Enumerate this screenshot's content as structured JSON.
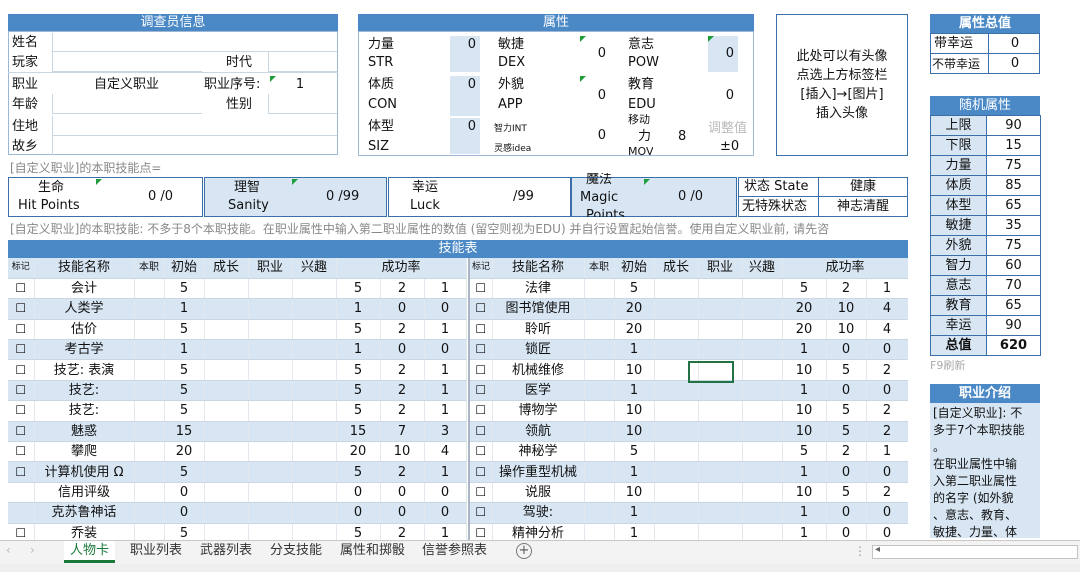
{
  "investigator": {
    "header": "调查员信息",
    "name_label": "姓名",
    "player_label": "玩家",
    "era_label": "时代",
    "occupation_label": "职业",
    "occupation_value": "自定义职业",
    "occ_index_label": "职业序号:",
    "occ_index_value": "1",
    "age_label": "年龄",
    "gender_label": "性别",
    "residence_label": "住地",
    "hometown_label": "故乡"
  },
  "attributes": {
    "header": "属性",
    "items": [
      {
        "cn": "力量",
        "en": "STR",
        "value": "0"
      },
      {
        "cn": "体质",
        "en": "CON",
        "value": "0"
      },
      {
        "cn": "体型",
        "en": "SIZ",
        "value": "0"
      },
      {
        "cn": "敏捷",
        "en": "DEX",
        "value": "0"
      },
      {
        "cn": "外貌",
        "en": "APP",
        "value": "0"
      },
      {
        "cn": "智力INT",
        "en": "灵感idea",
        "value": "0"
      },
      {
        "cn": "意志",
        "en": "POW",
        "value": "0"
      },
      {
        "cn": "教育",
        "en": "EDU",
        "value": "0"
      }
    ],
    "move_label_top": "移动",
    "move_label_mid": "力",
    "move_label_bot": "MOV",
    "move_value": "8",
    "adjust_label": "调整值",
    "adjust_value": "±0"
  },
  "portrait": {
    "line1": "此处可以有头像",
    "line2": "点选上方标签栏",
    "line3": "[插入]→[图片]",
    "line4": "插入头像"
  },
  "totals": {
    "header": "属性总值",
    "with_luck_label": "带幸运",
    "with_luck_value": "0",
    "without_luck_label": "不带幸运",
    "without_luck_value": "0"
  },
  "random": {
    "header": "随机属性",
    "rows": [
      {
        "label": "上限",
        "value": "90"
      },
      {
        "label": "下限",
        "value": "15"
      },
      {
        "label": "力量",
        "value": "75"
      },
      {
        "label": "体质",
        "value": "85"
      },
      {
        "label": "体型",
        "value": "65"
      },
      {
        "label": "敏捷",
        "value": "35"
      },
      {
        "label": "外貌",
        "value": "75"
      },
      {
        "label": "智力",
        "value": "60"
      },
      {
        "label": "意志",
        "value": "70"
      },
      {
        "label": "教育",
        "value": "65"
      },
      {
        "label": "幸运",
        "value": "90"
      },
      {
        "label": "总值",
        "value": "620"
      }
    ],
    "refresh_hint": "F9刷新"
  },
  "occupation_intro": {
    "header": "职业介绍",
    "text1": "[自定义职业]: 不",
    "text2": "多于7个本职技能",
    "text3": "。",
    "text4": "在职业属性中输",
    "text5": "入第二职业属性",
    "text6": "的名字 (如外貌",
    "text7": "、意志、教育、",
    "text8": "敏捷、力量、体"
  },
  "points_line": "[自定义职业]的本职技能点=",
  "stats": {
    "hp_cn": "生命",
    "hp_en": "Hit Points",
    "hp_value": "0 /0",
    "san_cn": "理智",
    "san_en": "Sanity",
    "san_value": "0 /99",
    "luck_cn": "幸运",
    "luck_en": "Luck",
    "luck_value": "/99",
    "mp_cn": "魔法",
    "mp_en": "Magic",
    "mp_en2": "Points",
    "mp_value": "0 /0",
    "state_label": "状态 State",
    "state_value": "健康",
    "special_label": "无特殊状态",
    "special_value": "神志清醒"
  },
  "skills_note": "[自定义职业]的本职技能: 不多于8个本职技能。在职业属性中输入第二职业属性的数值 (留空则视为EDU) 并自行设置起始信誉。使用自定义职业前, 请先咨",
  "skills": {
    "header": "技能表",
    "col_mark": "标记",
    "col_name": "技能名称",
    "col_occ": "本职",
    "col_init": "初始",
    "col_growth": "成长",
    "col_job": "职业",
    "col_interest": "兴趣",
    "col_success": "成功率",
    "left": [
      {
        "mark": "☐",
        "name": "会计",
        "init": "5",
        "s1": "5",
        "s2": "2",
        "s3": "1"
      },
      {
        "mark": "☐",
        "name": "人类学",
        "init": "1",
        "s1": "1",
        "s2": "0",
        "s3": "0"
      },
      {
        "mark": "☐",
        "name": "估价",
        "init": "5",
        "s1": "5",
        "s2": "2",
        "s3": "1"
      },
      {
        "mark": "☐",
        "name": "考古学",
        "init": "1",
        "s1": "1",
        "s2": "0",
        "s3": "0"
      },
      {
        "mark": "☐",
        "name": "技艺: 表演",
        "init": "5",
        "s1": "5",
        "s2": "2",
        "s3": "1"
      },
      {
        "mark": "☐",
        "name": "技艺:",
        "init": "5",
        "s1": "5",
        "s2": "2",
        "s3": "1"
      },
      {
        "mark": "☐",
        "name": "技艺:",
        "init": "5",
        "s1": "5",
        "s2": "2",
        "s3": "1"
      },
      {
        "mark": "☐",
        "name": "魅惑",
        "init": "15",
        "s1": "15",
        "s2": "7",
        "s3": "3"
      },
      {
        "mark": "☐",
        "name": "攀爬",
        "init": "20",
        "s1": "20",
        "s2": "10",
        "s3": "4"
      },
      {
        "mark": "☐",
        "name": "计算机使用 Ω",
        "init": "5",
        "s1": "5",
        "s2": "2",
        "s3": "1"
      },
      {
        "mark": "",
        "name": "信用评级",
        "init": "0",
        "s1": "0",
        "s2": "0",
        "s3": "0"
      },
      {
        "mark": "",
        "name": "克苏鲁神话",
        "init": "0",
        "s1": "0",
        "s2": "0",
        "s3": "0"
      },
      {
        "mark": "☐",
        "name": "乔装",
        "init": "5",
        "s1": "5",
        "s2": "2",
        "s3": "1"
      }
    ],
    "right": [
      {
        "mark": "☐",
        "name": "法律",
        "init": "5",
        "s1": "5",
        "s2": "2",
        "s3": "1"
      },
      {
        "mark": "☐",
        "name": "图书馆使用",
        "init": "20",
        "s1": "20",
        "s2": "10",
        "s3": "4"
      },
      {
        "mark": "☐",
        "name": "聆听",
        "init": "20",
        "s1": "20",
        "s2": "10",
        "s3": "4"
      },
      {
        "mark": "☐",
        "name": "锁匠",
        "init": "1",
        "s1": "1",
        "s2": "0",
        "s3": "0"
      },
      {
        "mark": "☐",
        "name": "机械维修",
        "init": "10",
        "s1": "10",
        "s2": "5",
        "s3": "2"
      },
      {
        "mark": "☐",
        "name": "医学",
        "init": "1",
        "s1": "1",
        "s2": "0",
        "s3": "0"
      },
      {
        "mark": "☐",
        "name": "博物学",
        "init": "10",
        "s1": "10",
        "s2": "5",
        "s3": "2"
      },
      {
        "mark": "☐",
        "name": "领航",
        "init": "10",
        "s1": "10",
        "s2": "5",
        "s3": "2"
      },
      {
        "mark": "☐",
        "name": "神秘学",
        "init": "5",
        "s1": "5",
        "s2": "2",
        "s3": "1"
      },
      {
        "mark": "☐",
        "name": "操作重型机械",
        "init": "1",
        "s1": "1",
        "s2": "0",
        "s3": "0"
      },
      {
        "mark": "☐",
        "name": "说服",
        "init": "10",
        "s1": "10",
        "s2": "5",
        "s3": "2"
      },
      {
        "mark": "☐",
        "name": "驾驶:",
        "init": "1",
        "s1": "1",
        "s2": "0",
        "s3": "0"
      },
      {
        "mark": "☐",
        "name": "精神分析",
        "init": "1",
        "s1": "1",
        "s2": "0",
        "s3": "0"
      }
    ]
  },
  "sheet_tabs": [
    "人物卡",
    "职业列表",
    "武器列表",
    "分支技能",
    "属性和掷骰",
    "信誉参照表"
  ],
  "add_sheet_icon": "plus-circle-icon",
  "colors": {
    "header_blue": "#4a88c6",
    "light_blue": "#d8e6f4",
    "active_tab_green": "#1b7a3a"
  }
}
